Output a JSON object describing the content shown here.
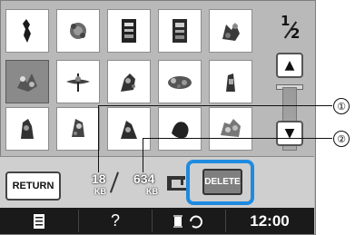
{
  "pager": {
    "current": "1",
    "total": "2"
  },
  "scroll": {
    "up_glyph": "▲",
    "down_glyph": "▼"
  },
  "thumbnails": [
    {
      "icon": "embroidery-design-icon"
    },
    {
      "icon": "embroidery-design-icon"
    },
    {
      "icon": "embroidery-design-icon"
    },
    {
      "icon": "embroidery-design-icon"
    },
    {
      "icon": "embroidery-design-icon"
    },
    {
      "icon": "embroidery-design-icon",
      "selected": true
    },
    {
      "icon": "embroidery-design-icon"
    },
    {
      "icon": "embroidery-design-icon"
    },
    {
      "icon": "embroidery-design-icon"
    },
    {
      "icon": "embroidery-design-icon"
    },
    {
      "icon": "embroidery-design-icon"
    },
    {
      "icon": "embroidery-design-icon"
    },
    {
      "icon": "embroidery-design-icon"
    },
    {
      "icon": "embroidery-design-icon"
    },
    {
      "icon": "embroidery-design-icon"
    }
  ],
  "toolbar": {
    "return_label": "RETURN",
    "design_size": "18",
    "design_size_unit": "KB",
    "free_space": "634",
    "free_space_unit": "KB",
    "delete_label": "DELETE"
  },
  "status": {
    "help_glyph": "?",
    "time": "12:00"
  },
  "callouts": [
    "①",
    "②"
  ],
  "colors": {
    "highlight": "#1e8be0",
    "screen_bg": "#b9b9b9",
    "statusbar": "#1a1a1a"
  }
}
